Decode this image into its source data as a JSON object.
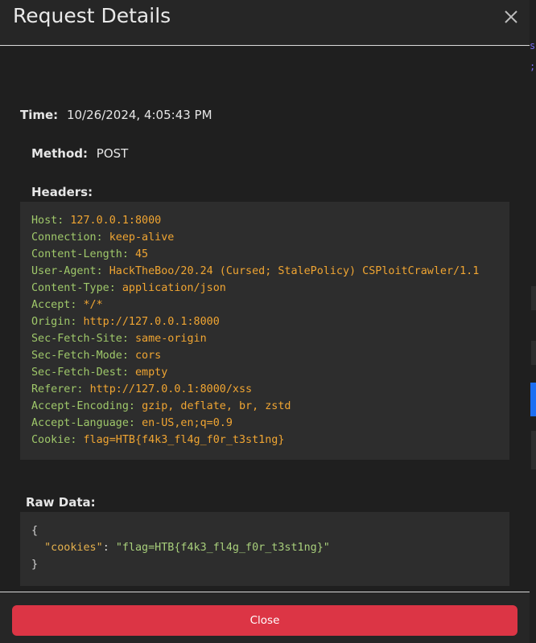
{
  "modal": {
    "title": "Request Details",
    "close_button_label": "Close"
  },
  "request": {
    "time_label": "Time:",
    "time_value": "10/26/2024, 4:05:43 PM",
    "method_label": "Method:",
    "method_value": "POST",
    "headers_label": "Headers:",
    "headers": [
      {
        "key": "Host:",
        "value": "127.0.0.1:8000"
      },
      {
        "key": "Connection:",
        "value": "keep-alive"
      },
      {
        "key": "Content-Length:",
        "value": "45"
      },
      {
        "key": "User-Agent:",
        "value": "HackTheBoo/20.24 (Cursed; StalePolicy) CSPloitCrawler/1.1"
      },
      {
        "key": "Content-Type:",
        "value": "application/json"
      },
      {
        "key": "Accept:",
        "value": "*/*"
      },
      {
        "key": "Origin:",
        "value": "http://127.0.0.1:8000"
      },
      {
        "key": "Sec-Fetch-Site:",
        "value": "same-origin"
      },
      {
        "key": "Sec-Fetch-Mode:",
        "value": "cors"
      },
      {
        "key": "Sec-Fetch-Dest:",
        "value": "empty"
      },
      {
        "key": "Referer:",
        "value": "http://127.0.0.1:8000/xss"
      },
      {
        "key": "Accept-Encoding:",
        "value": "gzip, deflate, br, zstd"
      },
      {
        "key": "Accept-Language:",
        "value": "en-US,en;q=0.9"
      },
      {
        "key": "Cookie:",
        "value": "flag=HTB{f4k3_fl4g_f0r_t3st1ng}"
      }
    ],
    "raw_data_label": "Raw Data:",
    "raw_data": {
      "open_brace": "{",
      "key": "\"cookies\"",
      "separator": ": ",
      "value": "\"flag=HTB{f4k3_fl4g_f0r_t3st1ng}\"",
      "close_brace": "}"
    }
  },
  "background": {
    "code_fragments": [
      "s",
      ";"
    ]
  },
  "colors": {
    "header_key": "#9fc86a",
    "header_value": "#f0a532",
    "close_button": "#dc3545"
  }
}
